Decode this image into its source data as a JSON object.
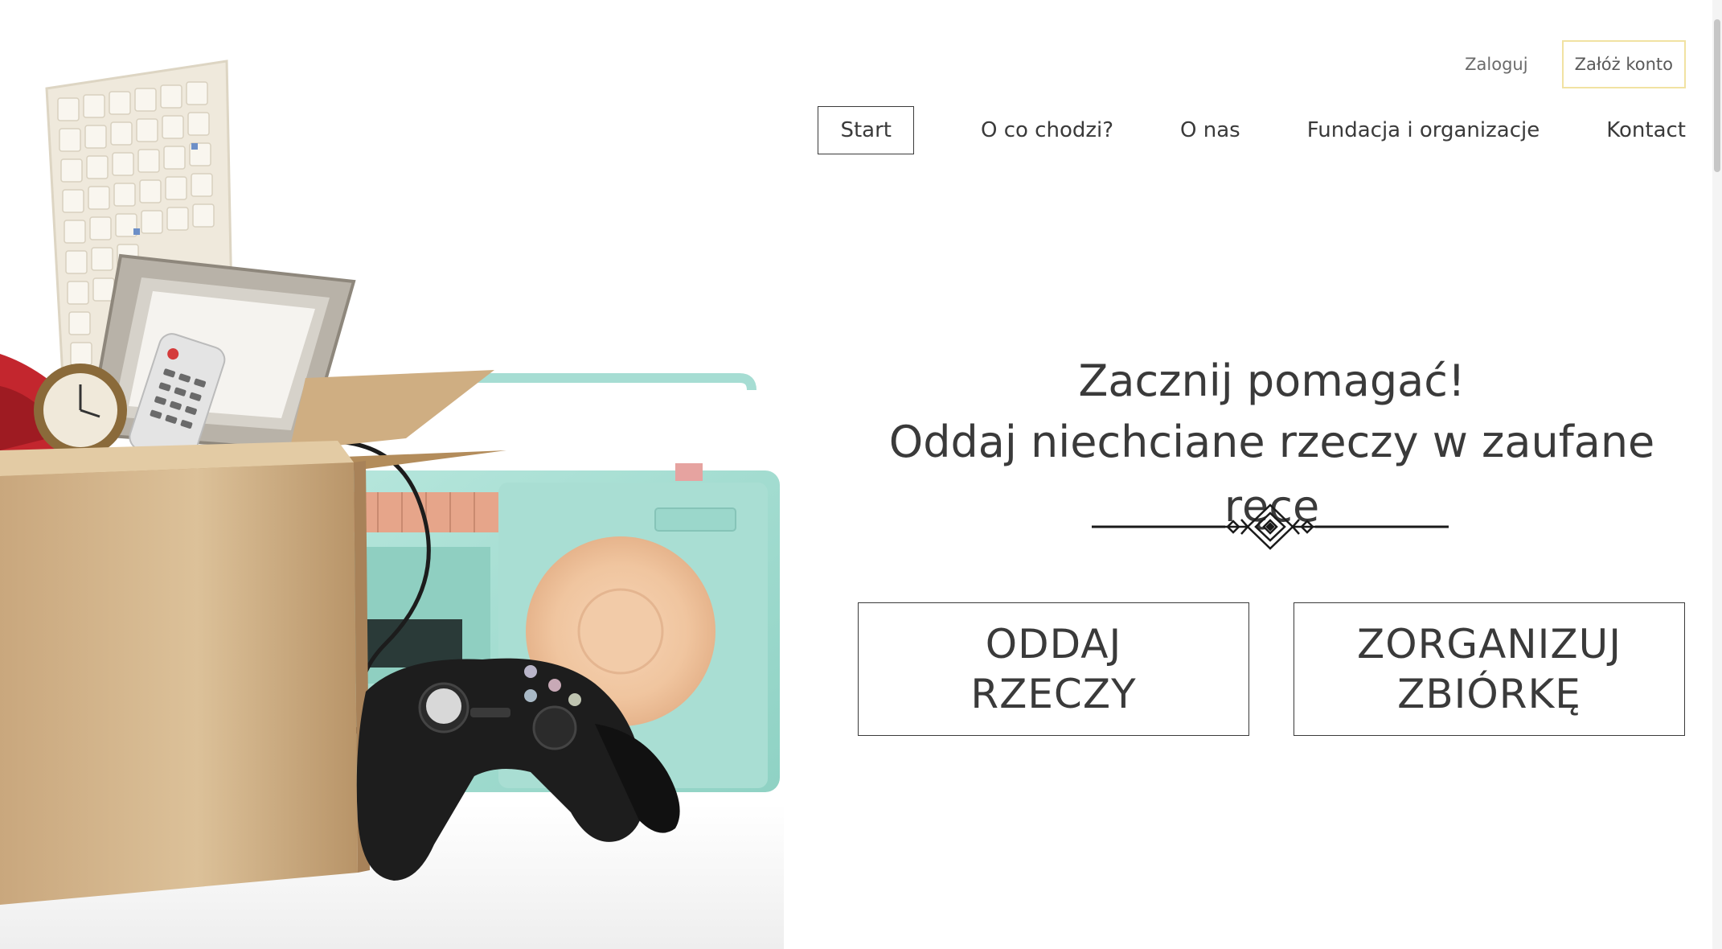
{
  "header": {
    "login_label": "Zaloguj",
    "register_label": "Załóż konto",
    "accent_border": "#f1e2a2"
  },
  "nav": {
    "items": [
      {
        "label": "Start",
        "active": true
      },
      {
        "label": "O co chodzi?",
        "active": false
      },
      {
        "label": "O nas",
        "active": false
      },
      {
        "label": "Fundacja i organizacje",
        "active": false
      },
      {
        "label": "Kontact",
        "active": false
      }
    ]
  },
  "hero": {
    "heading_line1": "Zacznij pomagać!",
    "heading_line2": "Oddaj niechciane rzeczy w zaufane ręce",
    "ornament_icon": "decorative-divider-icon",
    "image_description_icon": "donation-box-illustration"
  },
  "cta": {
    "give": {
      "line1": "ODDAJ",
      "line2": "RZECZY"
    },
    "organize": {
      "line1": "ZORGANIZUJ",
      "line2": "ZBIÓRKĘ"
    }
  },
  "colors": {
    "text": "#3a3a3a",
    "radio": "#a6ddd3",
    "box": "#d4b48c",
    "speaker": "#f1c9a6"
  }
}
